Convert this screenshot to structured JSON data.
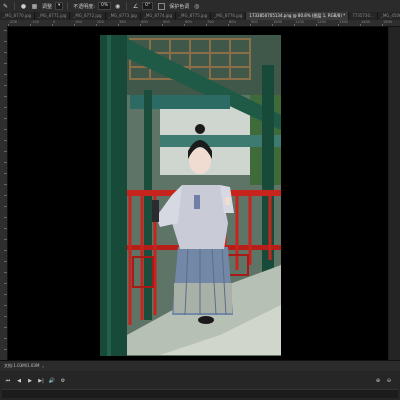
{
  "options_bar": {
    "sample_label": "调整",
    "opacity_label": "不透明度:",
    "opacity_value": "0%",
    "angle_value": "0°",
    "checkbox_label": "保护色调"
  },
  "tabs": [
    {
      "label": "_MG_8770.jpg",
      "active": false
    },
    {
      "label": "_MG_8771.jpg",
      "active": false
    },
    {
      "label": "_MG_8772.jpg",
      "active": false
    },
    {
      "label": "_MG_8773.jpg",
      "active": false
    },
    {
      "label": "_MG_8774.jpg",
      "active": false
    },
    {
      "label": "_MG_8775.jpg",
      "active": false
    },
    {
      "label": "_MG_8776.jpg",
      "active": false
    },
    {
      "label": "1733850705134.png @ 80.8% (图层 1, RGB/8) *",
      "active": true
    },
    {
      "label": "7735730...",
      "active": false
    },
    {
      "label": "_MG_4506.jpg",
      "active": false
    }
  ],
  "ruler_h": [
    "-200",
    "-100",
    "0",
    "100",
    "200",
    "300",
    "400",
    "500",
    "600",
    "700",
    "800",
    "900",
    "1000",
    "1100",
    "1200",
    "1300",
    "1400",
    "1500"
  ],
  "status": {
    "text": "文档:1.03M/1.03M"
  },
  "timeline": {
    "controls": [
      "⏮",
      "◀",
      "▶",
      "▶|",
      "🔊",
      "⚙"
    ],
    "right_icons": [
      "⊕",
      "⊖"
    ]
  },
  "colors": {
    "accent_red": "#c8241e",
    "pillar_green": "#174a38",
    "skirt_blue": "#7288a6"
  }
}
